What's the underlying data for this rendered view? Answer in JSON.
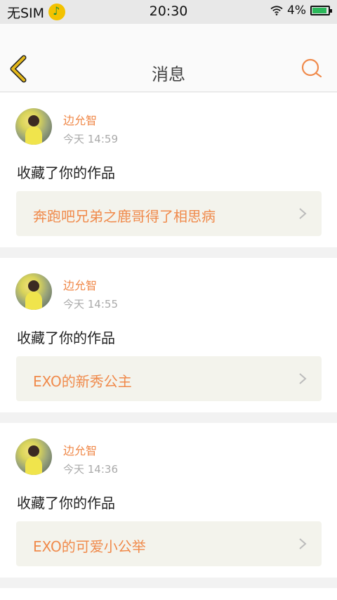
{
  "status_bar": {
    "carrier": "无SIM",
    "time": "20:30",
    "battery": "4%"
  },
  "header": {
    "title": "消息"
  },
  "messages": [
    {
      "username": "边允智",
      "timestamp": "今天 14:59",
      "action": "收藏了你的作品",
      "work_title": "奔跑吧兄弟之鹿哥得了相思病"
    },
    {
      "username": "边允智",
      "timestamp": "今天 14:55",
      "action": "收藏了你的作品",
      "work_title": "EXO的新秀公主"
    },
    {
      "username": "边允智",
      "timestamp": "今天 14:36",
      "action": "收藏了你的作品",
      "work_title": "EXO的可爱小公举"
    }
  ],
  "colors": {
    "accent": "#f08a4b",
    "back_icon": "#e4b81a"
  },
  "icons": {
    "back": "back-chevron-icon",
    "search": "search-icon",
    "music_app": "qq-music-icon",
    "wifi": "wifi-icon",
    "battery": "battery-icon"
  }
}
